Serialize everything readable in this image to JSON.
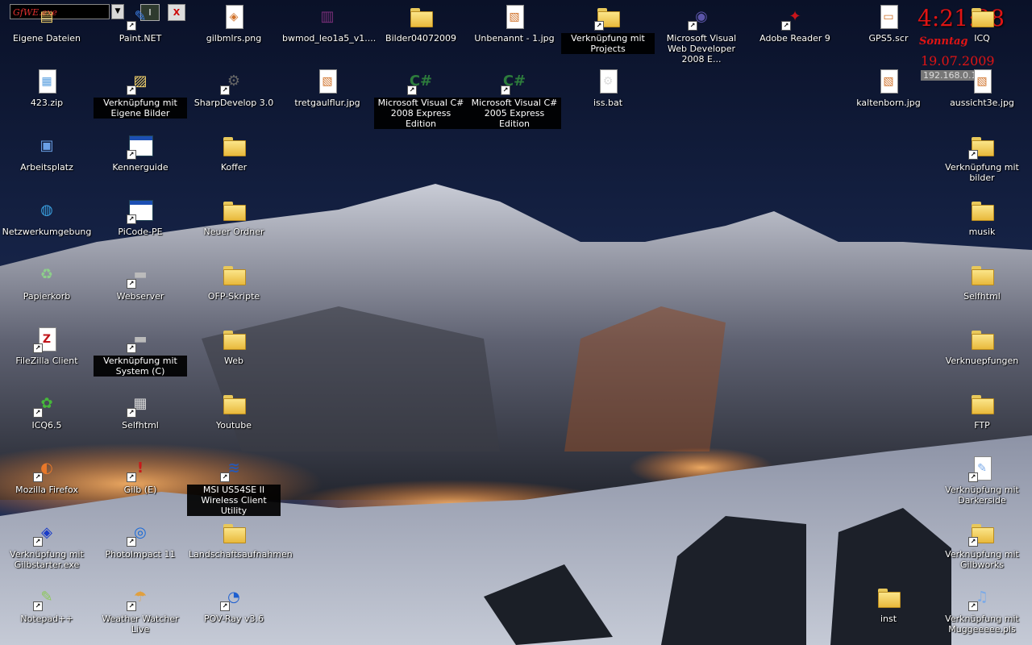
{
  "widget": {
    "field_text": "GfWE.exe",
    "minimize_label": "I",
    "close_label": "X"
  },
  "clock": {
    "time": "4:21:38",
    "weekday": "Sonntag",
    "date": "19.07.2009",
    "ip": "192.168.0.133"
  },
  "colors": {
    "clock": "#e01414",
    "label_box": "#000000"
  },
  "icons": [
    {
      "label": "Eigene Dateien",
      "icon": "my-documents-icon",
      "shortcut": false
    },
    {
      "label": "Paint.NET",
      "icon": "paint-net-icon",
      "shortcut": true
    },
    {
      "label": "gilbmlrs.png",
      "icon": "png-file-icon",
      "shortcut": false
    },
    {
      "label": "bwmod_leo1a5_v1....",
      "icon": "rar-archive-icon",
      "shortcut": false
    },
    {
      "label": "Bilder04072009",
      "icon": "folder-icon",
      "shortcut": false
    },
    {
      "label": "Unbenannt - 1.jpg",
      "icon": "jpg-file-icon",
      "shortcut": false
    },
    {
      "label": "Verknüpfung mit Projects",
      "icon": "folder-shortcut-icon",
      "shortcut": true
    },
    {
      "label": "Microsoft Visual Web Developer 2008 E...",
      "icon": "vs-web-developer-icon",
      "shortcut": true
    },
    {
      "label": "Adobe Reader 9",
      "icon": "adobe-reader-icon",
      "shortcut": true
    },
    {
      "label": "GPS5.scr",
      "icon": "screensaver-file-icon",
      "shortcut": false
    },
    {
      "label": "ICQ",
      "icon": "folder-icon",
      "shortcut": false
    },
    {
      "label": "423.zip",
      "icon": "zip-file-icon",
      "shortcut": false
    },
    {
      "label": "Verknüpfung mit Eigene Bilder",
      "icon": "pictures-folder-shortcut-icon",
      "shortcut": true
    },
    {
      "label": "SharpDevelop 3.0",
      "icon": "sharpdevelop-icon",
      "shortcut": true
    },
    {
      "label": "tretgaulflur.jpg",
      "icon": "jpg-file-icon",
      "shortcut": false
    },
    {
      "label": "Microsoft Visual C# 2008 Express Edition",
      "icon": "csharp-icon",
      "shortcut": true
    },
    {
      "label": "Microsoft Visual C# 2005 Express Edition",
      "icon": "csharp-icon",
      "shortcut": true
    },
    {
      "label": "iss.bat",
      "icon": "batch-file-icon",
      "shortcut": false
    },
    {
      "label": "kaltenborn.jpg",
      "icon": "jpg-file-icon",
      "shortcut": false
    },
    {
      "label": "aussicht3e.jpg",
      "icon": "jpg-file-icon",
      "shortcut": false
    },
    {
      "label": "Arbeitsplatz",
      "icon": "my-computer-icon",
      "shortcut": false
    },
    {
      "label": "Kennerguide",
      "icon": "window-shortcut-icon",
      "shortcut": true
    },
    {
      "label": "Koffer",
      "icon": "folder-icon",
      "shortcut": false
    },
    {
      "label": "Verknüpfung mit bilder",
      "icon": "folder-shortcut-icon",
      "shortcut": true
    },
    {
      "label": "Netzwerkumgebung",
      "icon": "network-places-icon",
      "shortcut": false
    },
    {
      "label": "PiCode-PE",
      "icon": "window-shortcut-icon",
      "shortcut": true
    },
    {
      "label": "Neuer Ordner",
      "icon": "folder-icon",
      "shortcut": false
    },
    {
      "label": "musik",
      "icon": "folder-icon",
      "shortcut": false
    },
    {
      "label": "Papierkorb",
      "icon": "recycle-bin-icon",
      "shortcut": false
    },
    {
      "label": "Webserver",
      "icon": "server-icon",
      "shortcut": true
    },
    {
      "label": "OFP-Skripte",
      "icon": "folder-icon",
      "shortcut": false
    },
    {
      "label": "Selfhtml",
      "icon": "folder-icon",
      "shortcut": false
    },
    {
      "label": "FileZilla Client",
      "icon": "filezilla-icon",
      "shortcut": true
    },
    {
      "label": "Verknüpfung mit System (C)",
      "icon": "drive-shortcut-icon",
      "shortcut": true
    },
    {
      "label": "Web",
      "icon": "folder-icon",
      "shortcut": false
    },
    {
      "label": "Verknuepfungen",
      "icon": "folder-icon",
      "shortcut": false
    },
    {
      "label": "ICQ6.5",
      "icon": "icq-flower-icon",
      "shortcut": true
    },
    {
      "label": "Selfhtml",
      "icon": "selfhtml-icon",
      "shortcut": true
    },
    {
      "label": "Youtube",
      "icon": "folder-icon",
      "shortcut": false
    },
    {
      "label": "FTP",
      "icon": "folder-icon",
      "shortcut": false
    },
    {
      "label": "Mozilla Firefox",
      "icon": "firefox-icon",
      "shortcut": true
    },
    {
      "label": "Gilb (E)",
      "icon": "drive-error-icon",
      "shortcut": true
    },
    {
      "label": "MSI US54SE II Wireless Client Utility",
      "icon": "msi-wireless-icon",
      "shortcut": true
    },
    {
      "label": "Verknüpfung mit Darkerside",
      "icon": "file-shortcut-icon",
      "shortcut": true
    },
    {
      "label": "Verknüpfung mit Gilbstarter.exe",
      "icon": "app-shortcut-icon",
      "shortcut": true
    },
    {
      "label": "PhotoImpact 11",
      "icon": "photoimpact-icon",
      "shortcut": true
    },
    {
      "label": "Landschaftsaufnahmen",
      "icon": "folder-icon",
      "shortcut": false
    },
    {
      "label": "Verknüpfung mit Gilbworks",
      "icon": "folder-shortcut-icon",
      "shortcut": true
    },
    {
      "label": "Notepad++",
      "icon": "notepad-plus-plus-icon",
      "shortcut": true
    },
    {
      "label": "Weather Watcher Live",
      "icon": "weather-watcher-icon",
      "shortcut": true
    },
    {
      "label": "POV-Ray v3.6",
      "icon": "povray-icon",
      "shortcut": true
    },
    {
      "label": "inst",
      "icon": "folder-icon",
      "shortcut": false
    },
    {
      "label": "Verknüpfung mit Muggeeeee.pls",
      "icon": "playlist-shortcut-icon",
      "shortcut": true
    }
  ]
}
